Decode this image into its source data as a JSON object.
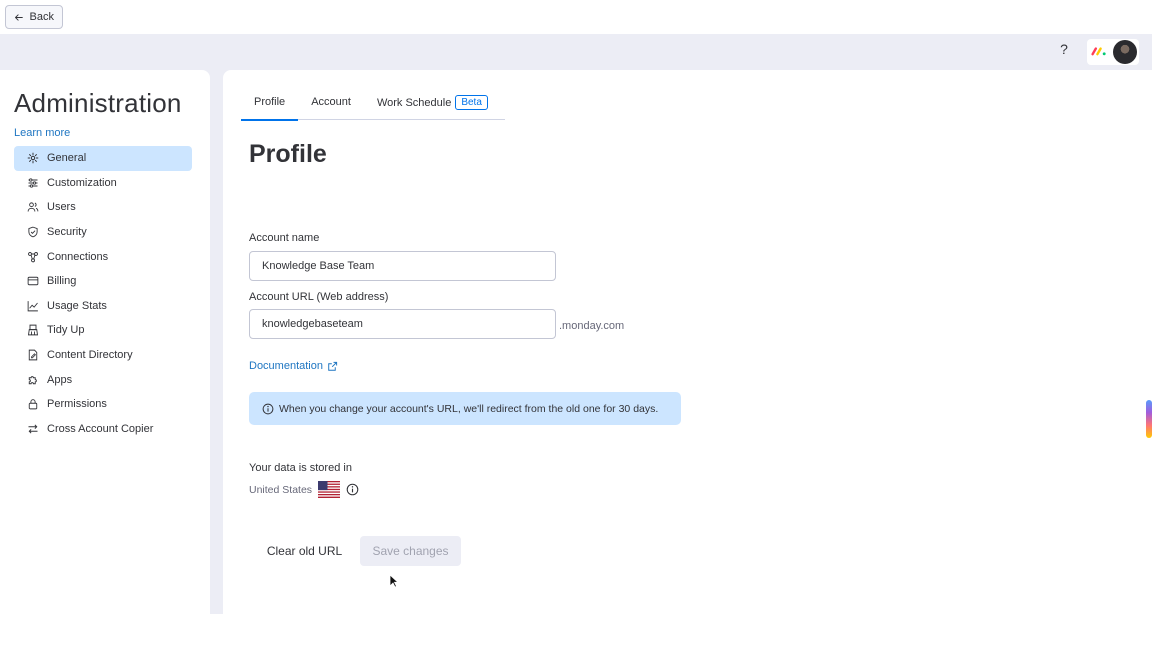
{
  "topbar": {
    "back_label": "Back",
    "help_label": "?",
    "colors": {
      "accent": "#0073ea",
      "frame": "#ecedf5"
    }
  },
  "sidebar": {
    "title": "Administration",
    "learn_more": "Learn more",
    "items": [
      {
        "label": "General",
        "icon": "gear-icon",
        "active": true
      },
      {
        "label": "Customization",
        "icon": "sliders-icon"
      },
      {
        "label": "Users",
        "icon": "users-icon"
      },
      {
        "label": "Security",
        "icon": "shield-icon"
      },
      {
        "label": "Connections",
        "icon": "connections-icon"
      },
      {
        "label": "Billing",
        "icon": "credit-card-icon"
      },
      {
        "label": "Usage Stats",
        "icon": "chart-icon"
      },
      {
        "label": "Tidy Up",
        "icon": "broom-icon"
      },
      {
        "label": "Content Directory",
        "icon": "document-icon"
      },
      {
        "label": "Apps",
        "icon": "puzzle-icon"
      },
      {
        "label": "Permissions",
        "icon": "lock-icon"
      },
      {
        "label": "Cross Account Copier",
        "icon": "arrows-icon"
      }
    ]
  },
  "main": {
    "tabs": [
      {
        "label": "Profile",
        "active": true
      },
      {
        "label": "Account"
      },
      {
        "label": "Work Schedule",
        "badge": "Beta"
      }
    ],
    "page_title": "Profile",
    "account_name": {
      "label": "Account name",
      "value": "Knowledge Base Team"
    },
    "account_url": {
      "label": "Account URL (Web address)",
      "value": "knowledgebaseteam",
      "suffix": ".monday.com"
    },
    "documentation_link": "Documentation",
    "info_banner": "When you change your account's URL, we'll redirect from the old one for 30 days.",
    "storage": {
      "label": "Your data is stored in",
      "location": "United States"
    },
    "buttons": {
      "clear": "Clear old URL",
      "save": "Save changes"
    }
  }
}
